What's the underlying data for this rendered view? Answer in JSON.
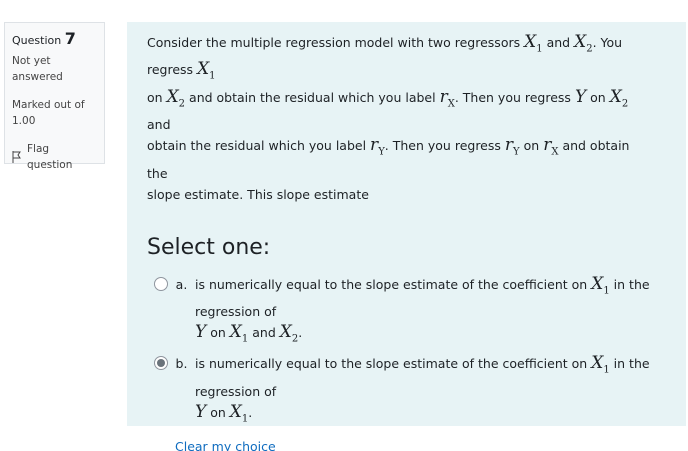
{
  "info": {
    "question_label": "Question",
    "question_number": "7",
    "state": "Not yet answered",
    "grade": "Marked out of 1.00",
    "flag_label": "Flag question"
  },
  "question": {
    "t1": "Consider the multiple regression model with two regressors",
    "m_X": "X",
    "s_1": "1",
    "s_2": "2",
    "w_and": "and",
    "t_you_regress": ". You regress",
    "w_on": "on",
    "t_residual_label": "and obtain the residual which you label",
    "m_r": "r",
    "sub_X": "X",
    "sub_Y": "Y",
    "t_then_regress": ". Then you regress",
    "m_Y": "Y",
    "t_and": "and",
    "t_obtain_residual": "obtain the residual which you label",
    "t_then_you_regress": ". Then you regress",
    "t_obtain_slope": "and obtain",
    "t_the": "the",
    "t_slope": "slope estimate. This slope estimate",
    "period": "."
  },
  "prompt": "Select one:",
  "options": [
    {
      "letter": "a.",
      "text": "is numerically equal to the slope estimate of the coefficient on",
      "text2": "in the regression of",
      "checked": false
    },
    {
      "letter": "b.",
      "text": "is numerically equal to the slope estimate of the coefficient on",
      "text2": "in the regression of",
      "checked": true
    }
  ],
  "clear_label": "Clear my choice"
}
